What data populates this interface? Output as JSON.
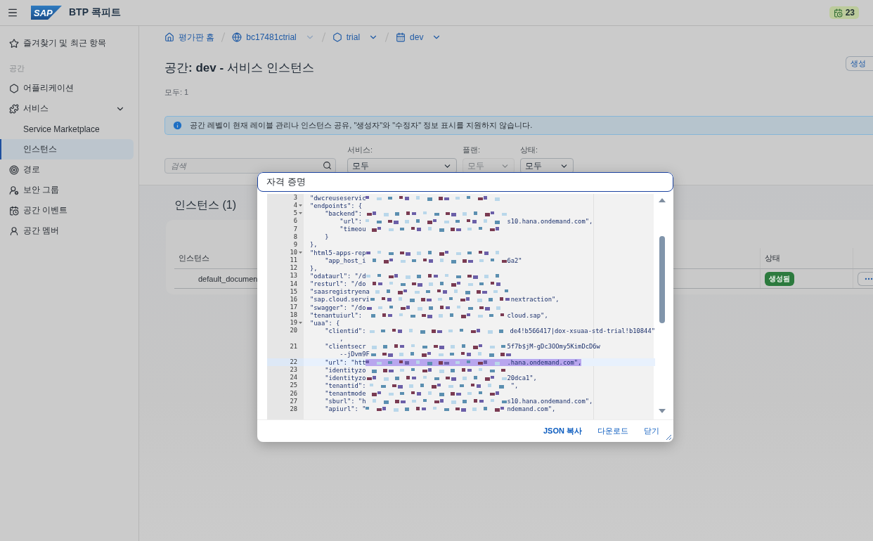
{
  "header": {
    "logo": "SAP",
    "title": "BTP 콕피트",
    "badge": "23"
  },
  "sidebar": {
    "favorites": "즐겨찾기 및 최근 항목",
    "section": "공간",
    "items": [
      {
        "label": "어플리케이션",
        "selected": false
      },
      {
        "label": "서비스",
        "selected": false,
        "expanded": true,
        "children": [
          {
            "label": "Service Marketplace",
            "selected": false
          },
          {
            "label": "인스턴스",
            "selected": true
          }
        ]
      },
      {
        "label": "경로",
        "selected": false
      },
      {
        "label": "보안 그룹",
        "selected": false
      },
      {
        "label": "공간 이벤트",
        "selected": false
      },
      {
        "label": "공간 멤버",
        "selected": false
      }
    ]
  },
  "breadcrumb": [
    {
      "label": "평가판 홈",
      "dropdown": false
    },
    {
      "label": "bc17481ctrial",
      "dropdown": true
    },
    {
      "label": "trial",
      "dropdown": true
    },
    {
      "label": "dev",
      "dropdown": true
    }
  ],
  "page": {
    "title": "공간**: dev -** 서비스 인스턴스",
    "count": "모두: 1",
    "create_button": "생성",
    "info": "공간 레벨이 현재 레이블 관리나 인스턴스 공유, \"생성자\"와 \"수정자\" 정보 표시를 지원하지 않습니다.",
    "search": {
      "placeholder": "검색"
    },
    "filters": [
      {
        "label": "서비스:",
        "value": "모두",
        "disabled": false
      },
      {
        "label": "플랜:",
        "value": "모두",
        "disabled": true
      },
      {
        "label": "상태:",
        "value": "모두",
        "disabled": false
      }
    ]
  },
  "instances": {
    "title": "인스턴스 (1)",
    "columns": [
      "인스턴스",
      "상태"
    ],
    "rows": [
      {
        "name": "default_documen",
        "status": "생성됨"
      }
    ]
  },
  "dialog": {
    "title": "자격 증명",
    "lines": [
      {
        "number": "3",
        "foldable": false,
        "head": "\"dwcreuseservic",
        "redacted": true,
        "highlighted": false
      },
      {
        "number": "4",
        "foldable": true,
        "head": "\"endpoints\": {",
        "redacted": false,
        "highlighted": false
      },
      {
        "number": "5",
        "foldable": true,
        "head": "    \"backend\": ",
        "redacted": true,
        "highlighted": false
      },
      {
        "number": "6",
        "foldable": false,
        "head": "        \"url\": ",
        "redacted": true,
        "tail": "s10.hana.ondemand.com\",",
        "highlighted": false
      },
      {
        "number": "7",
        "foldable": false,
        "head": "        \"timeou",
        "redacted": true,
        "highlighted": false
      },
      {
        "number": "8",
        "foldable": false,
        "head": "    }",
        "redacted": false,
        "highlighted": false
      },
      {
        "number": "9",
        "foldable": false,
        "head": "},",
        "redacted": false,
        "highlighted": false
      },
      {
        "number": "10",
        "foldable": true,
        "head": "\"html5-apps-rep",
        "redacted": true,
        "highlighted": false
      },
      {
        "number": "11",
        "foldable": false,
        "head": "    \"app_host_i",
        "redacted": true,
        "tail": "6a2\"",
        "highlighted": false
      },
      {
        "number": "12",
        "foldable": false,
        "head": "},",
        "redacted": false,
        "highlighted": false
      },
      {
        "number": "13",
        "foldable": false,
        "head": "\"odataurl\": \"/d",
        "redacted": true,
        "highlighted": false
      },
      {
        "number": "14",
        "foldable": false,
        "head": "\"resturl\": \"/do",
        "redacted": true,
        "highlighted": false
      },
      {
        "number": "15",
        "foldable": false,
        "head": "\"saasregistryena",
        "redacted": true,
        "highlighted": false
      },
      {
        "number": "16",
        "foldable": false,
        "head": "\"sap.cloud.servi",
        "redacted": true,
        "tail": "nextraction\",",
        "highlighted": false
      },
      {
        "number": "17",
        "foldable": false,
        "head": "\"swagger\": \"/do",
        "redacted": true,
        "highlighted": false
      },
      {
        "number": "18",
        "foldable": false,
        "head": "\"tenantuiurl\": ",
        "redacted": true,
        "tail": "cloud.sap\",",
        "highlighted": false
      },
      {
        "number": "19",
        "foldable": true,
        "head": "\"uaa\": {",
        "redacted": false,
        "highlighted": false
      },
      {
        "number": "20",
        "foldable": false,
        "head": "    \"clientid\": ",
        "redacted": true,
        "tail": "de4!b566417|dox-xsuaa-std-trial!b10844\"",
        "highlighted": false
      },
      {
        "foldable": false,
        "head": "        ,",
        "redacted": false,
        "highlighted": false
      },
      {
        "number": "21",
        "foldable": false,
        "head": "    \"clientsecr",
        "redacted": true,
        "tail": "5f7b$jM-gDc3OOmy5KimDcD6w",
        "highlighted": false
      },
      {
        "foldable": false,
        "head": "        --jDvm9F",
        "redacted": true,
        "highlighted": false
      },
      {
        "number": "22",
        "foldable": false,
        "head": "    \"url\": \"htt",
        "redacted": true,
        "tail": ".hana.ondemand.com\",",
        "highlighted": true
      },
      {
        "number": "23",
        "foldable": false,
        "head": "    \"identityzo",
        "redacted": true,
        "highlighted": false
      },
      {
        "number": "24",
        "foldable": false,
        "head": "    \"identityzo",
        "redacted": true,
        "tail": "20dca1\",",
        "highlighted": false
      },
      {
        "number": "25",
        "foldable": false,
        "head": "    \"tenantid\": ",
        "redacted": true,
        "tail": "\",",
        "highlighted": false
      },
      {
        "number": "26",
        "foldable": false,
        "head": "    \"tenantmode",
        "redacted": true,
        "highlighted": false
      },
      {
        "number": "27",
        "foldable": false,
        "head": "    \"sburl\": \"h",
        "redacted": true,
        "tail": "s10.hana.ondemand.com\",",
        "highlighted": false
      },
      {
        "number": "28",
        "foldable": false,
        "head": "    \"apiurl\": \"",
        "redacted": true,
        "tail": "ndemand.com\",",
        "highlighted": false
      }
    ],
    "buttons": [
      "JSON 복사",
      "다운로드",
      "닫기"
    ]
  }
}
